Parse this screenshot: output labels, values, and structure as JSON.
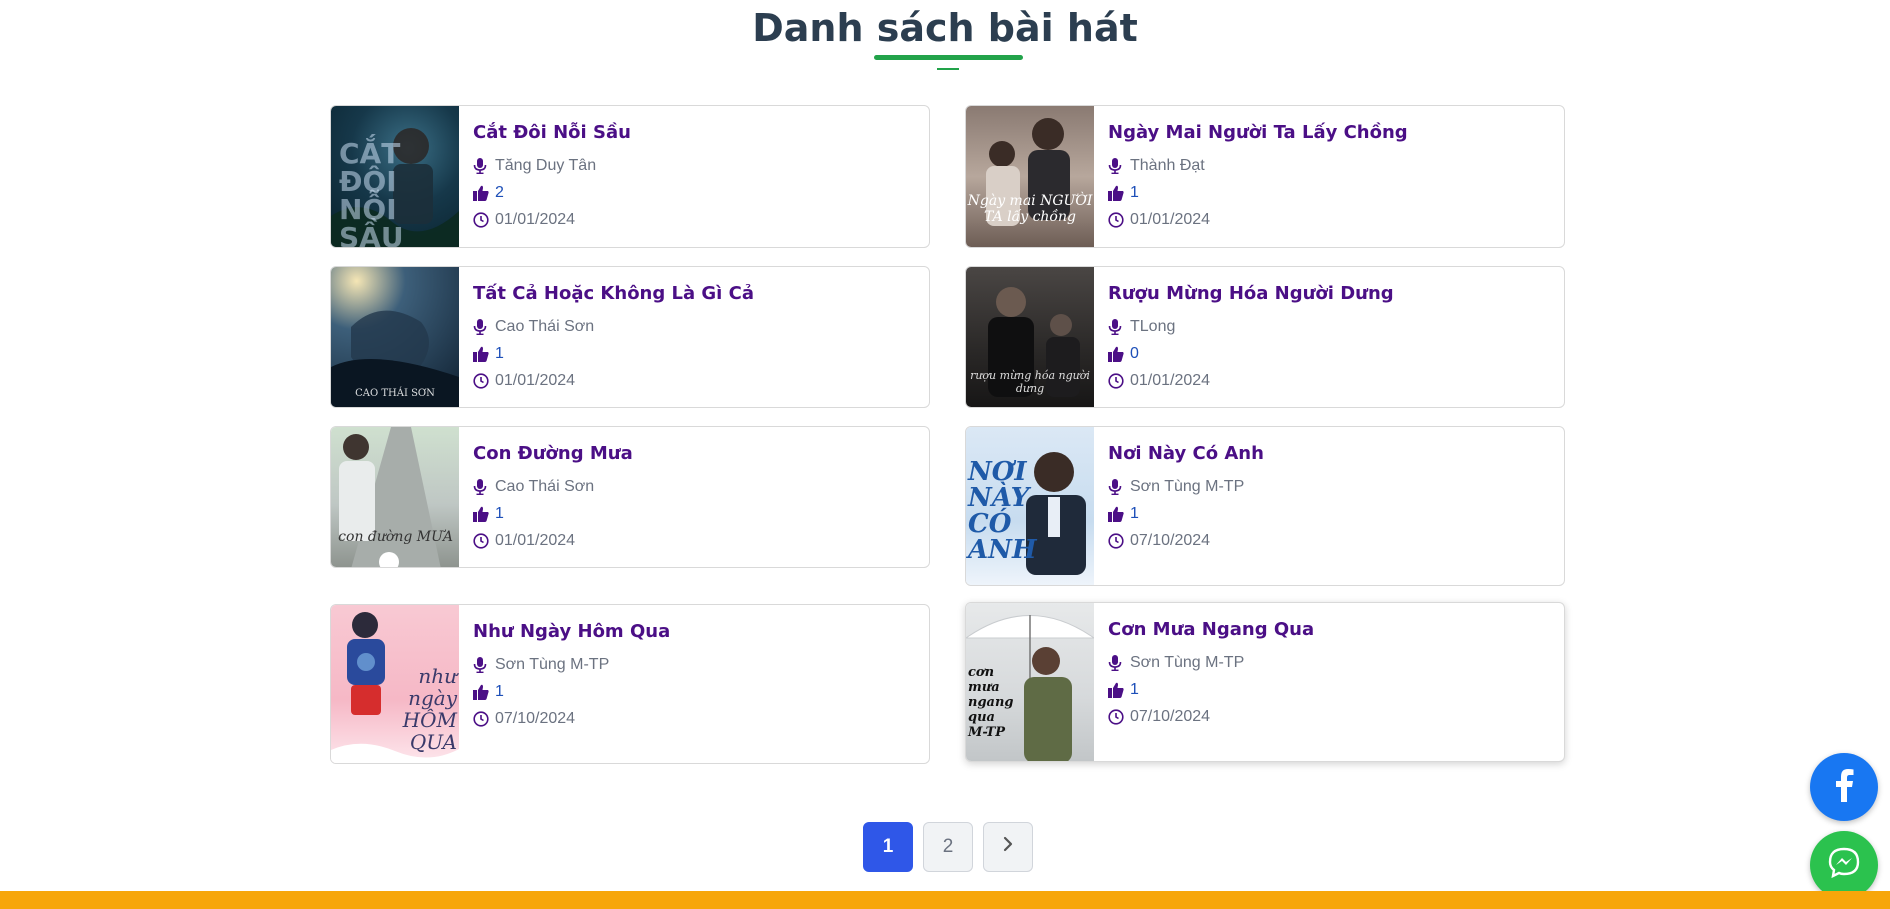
{
  "page": {
    "title": "Danh sách bài hát"
  },
  "songs": [
    {
      "title": "Cắt Đôi Nỗi Sầu",
      "artist": "Tăng Duy Tân",
      "likes": "2",
      "date": "01/01/2024",
      "cover_text": "CẮT ĐÔI NỖI SẦU"
    },
    {
      "title": "Ngày Mai Người Ta Lấy Chồng",
      "artist": "Thành Đạt",
      "likes": "1",
      "date": "01/01/2024",
      "cover_text": "Ngày mai NGƯỜI TA lấy chồng"
    },
    {
      "title": "Tất Cả Hoặc Không Là Gì Cả",
      "artist": "Cao Thái Sơn",
      "likes": "1",
      "date": "01/01/2024",
      "cover_text": "CAO THÁI SƠN"
    },
    {
      "title": "Rượu Mừng Hóa Người Dưng",
      "artist": "TLong",
      "likes": "0",
      "date": "01/01/2024",
      "cover_text": "rượu mừng hóa người dưng"
    },
    {
      "title": "Con Đường Mưa",
      "artist": "Cao Thái Sơn",
      "likes": "1",
      "date": "01/01/2024",
      "cover_text": "con đường MƯA"
    },
    {
      "title": "Nơi Này Có Anh",
      "artist": "Sơn Tùng M-TP",
      "likes": "1",
      "date": "07/10/2024",
      "cover_text": "NƠI NÀY CÓ ANH"
    },
    {
      "title": "Như Ngày Hôm Qua",
      "artist": "Sơn Tùng M-TP",
      "likes": "1",
      "date": "07/10/2024",
      "cover_text": "như ngày HÔM QUA"
    },
    {
      "title": "Cơn Mưa Ngang Qua",
      "artist": "Sơn Tùng M-TP",
      "likes": "1",
      "date": "07/10/2024",
      "cover_text": "cơn mưa ngang qua M-TP"
    }
  ],
  "pagination": {
    "pages": [
      "1",
      "2"
    ],
    "current": "1",
    "next_icon": "chevron-right-icon"
  },
  "floating_buttons": {
    "facebook_icon": "facebook-icon",
    "messenger_icon": "messenger-icon"
  },
  "colors": {
    "title": "#2c3e50",
    "accent_green": "#22a34a",
    "song_title": "#4b0f86",
    "likes": "#1d4fb8",
    "pager_active": "#2f57e8",
    "facebook": "#1877f2",
    "messenger": "#2bc24e",
    "footer": "#f7a60a"
  }
}
